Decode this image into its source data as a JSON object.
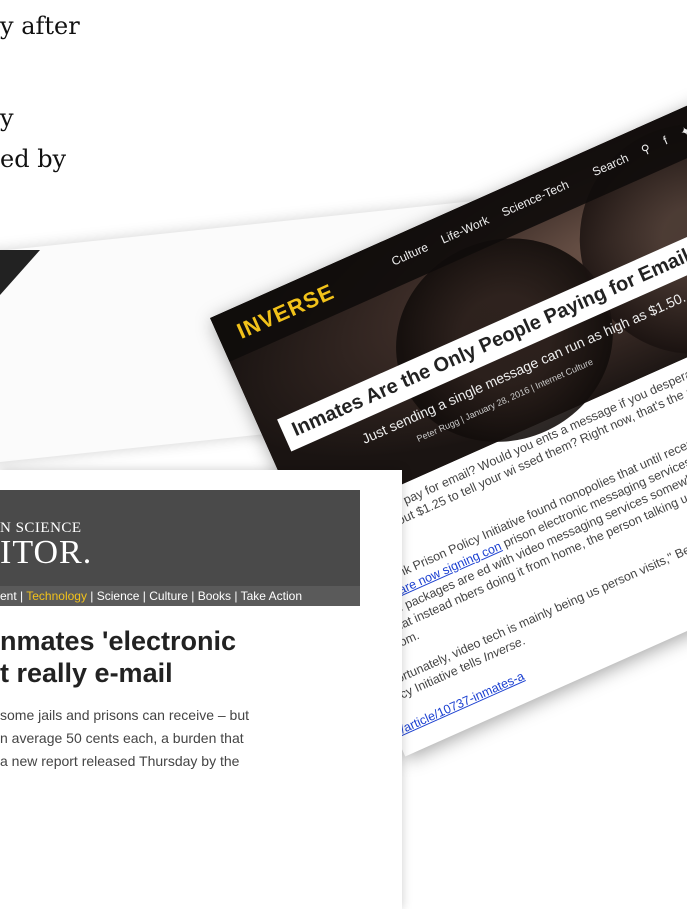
{
  "background": {
    "line1": "y after",
    "line2": "y",
    "line3": "ed by"
  },
  "inverse": {
    "logo": "INVERSE",
    "nav": [
      "Culture",
      "Life-Work",
      "Science-Tech",
      "Search"
    ],
    "title": "Inmates Are the Only People Paying for Email",
    "subtitle": "Just sending a single message can run as high as $1.50.",
    "meta": "Peter Rugg | January 28, 2016 | Internet Culture",
    "para1": "d you be willing to pay for email? Would you ents a message if you desperately needed to th a lawyer? How about $1.25 to tell your wi ssed them? Right now, that's the arithmetic ates are weighing.",
    "para2_pre": ", the think tank Prison Policy Initiative found nonopolies that until recently billed inmates r minute for a local call ",
    "para2_link": "are now signing con",
    "para2_post": " prison electronic messaging services, which a e rates at about 50 cents. The packages are ed with video messaging services somewhat ype or Apple's FaceTime, except that instead nbers doing it from home, the person talking ually does it on site at the prison in a monito om.",
    "para3_pre": "\"Unfortunately, video tech is mainly being us person visits,\" Bernadette Rabuy, senior poli Prison Policy Initiative tells ",
    "para3_em": "Inverse",
    "para3_post": ".",
    "link_bottom": "n/article/10737-inmates-a"
  },
  "monitor": {
    "brand_top": "N SCIENCE",
    "brand_logo": "ITOR.",
    "nav_pre": "ent | ",
    "nav_active": "Technology",
    "nav_post": " | Science | Culture | Books | Take Action",
    "headline_line1": "nmates 'electronic",
    "headline_line2": "t really e-mail",
    "para_line1": "some jails and prisons can receive – but",
    "para_line2": "n average 50 cents each, a burden that",
    "para_line3": "a new report released Thursday by the"
  }
}
